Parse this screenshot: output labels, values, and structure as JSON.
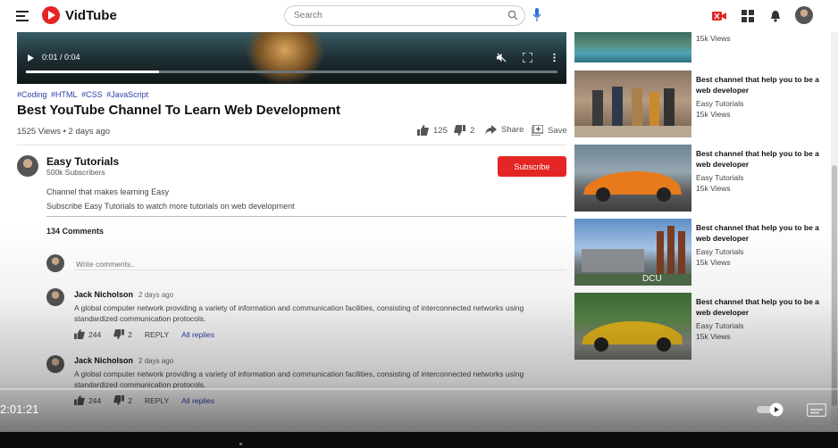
{
  "app": {
    "name": "VidTube",
    "brand_color": "#e42525"
  },
  "header": {
    "search_placeholder": "Search",
    "icons": [
      "menu-icon",
      "search-icon",
      "mic-icon",
      "live-camera-icon",
      "apps-grid-icon",
      "bell-icon",
      "avatar"
    ]
  },
  "player": {
    "time": "0:01 / 0:04",
    "progress": 0.25
  },
  "video": {
    "tags": [
      "#Coding",
      "#HTML",
      "#CSS",
      "#JavaScript"
    ],
    "title": "Best YouTube Channel To Learn Web Development",
    "views_date": "1525 Views • 2 days ago",
    "likes": "125",
    "dislikes": "2",
    "share_label": "Share",
    "save_label": "Save"
  },
  "channel": {
    "name": "Easy Tutorials",
    "subscribers": "500k Subscribers",
    "subscribe_label": "Subscribe",
    "desc1": "Channel that makes learning Easy",
    "desc2": "Subscribe Easy Tutorials to watch more tutorials on web development"
  },
  "comments": {
    "count_label": "134 Comments",
    "input_placeholder": "Write comments..",
    "items": [
      {
        "name": "Jack Nicholson",
        "time": "2 days ago",
        "text": "A global computer network providing a variety of information and communication facilities, consisting of interconnected networks using standardized communication protocols.",
        "likes": "244",
        "dislikes": "2",
        "reply": "REPLY",
        "all_replies": "All replies"
      },
      {
        "name": "Jack Nicholson",
        "time": "2 days ago",
        "text": "A global computer network providing a variety of information and communication facilities, consisting of interconnected networks using standardized communication protocols.",
        "likes": "244",
        "dislikes": "2",
        "reply": "REPLY",
        "all_replies": "All replies"
      }
    ]
  },
  "sidebar": {
    "top_views": "15k Views",
    "items": [
      {
        "title": "Best channel that help you to be a web developer",
        "channel": "Easy Tutorials",
        "views": "15k Views"
      },
      {
        "title": "Best channel that help you to be a web developer",
        "channel": "Easy Tutorials",
        "views": "15k Views"
      },
      {
        "title": "Best channel that help you to be a web developer",
        "channel": "Easy Tutorials",
        "views": "15k Views"
      },
      {
        "title": "Best channel that help you to be a web developer",
        "channel": "Easy Tutorials",
        "views": "15k Views"
      }
    ],
    "thumb_brand_text": "DCU"
  },
  "overlay_player": {
    "time": "2:01:21"
  }
}
